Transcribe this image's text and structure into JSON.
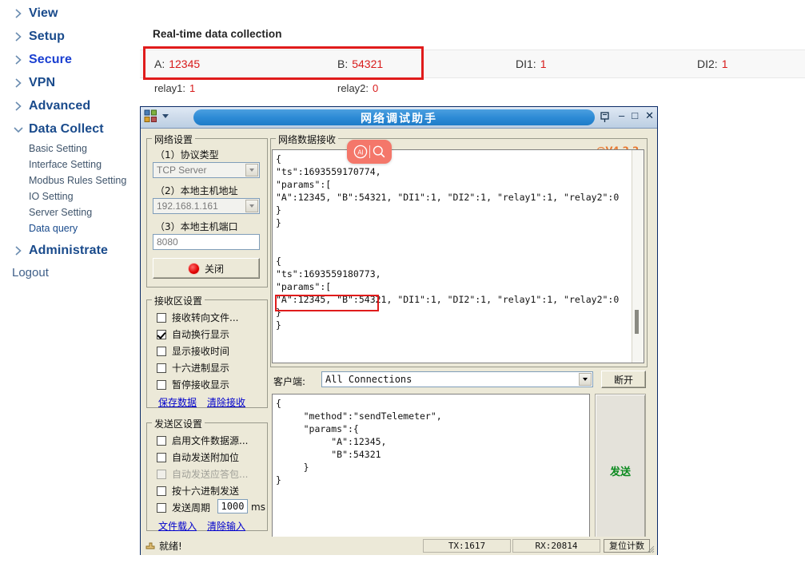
{
  "sidebar": {
    "nav": [
      {
        "label": "View",
        "expanded": false,
        "style": "dark"
      },
      {
        "label": "Setup",
        "expanded": false,
        "style": "dark"
      },
      {
        "label": "Secure",
        "expanded": false,
        "style": "bright"
      },
      {
        "label": "VPN",
        "expanded": false,
        "style": "dark"
      },
      {
        "label": "Advanced",
        "expanded": false,
        "style": "dark"
      },
      {
        "label": "Data Collect",
        "expanded": true,
        "style": "dark"
      }
    ],
    "sub_items": [
      {
        "label": "Basic Setting",
        "active": false
      },
      {
        "label": "Interface Setting",
        "active": false
      },
      {
        "label": "Modbus Rules Setting",
        "active": false
      },
      {
        "label": "IO Setting",
        "active": false
      },
      {
        "label": "Server Setting",
        "active": false
      },
      {
        "label": "Data query",
        "active": true
      }
    ],
    "nav_after": [
      {
        "label": "Administrate",
        "expanded": false,
        "style": "dark"
      }
    ],
    "logout": "Logout"
  },
  "main": {
    "section_title": "Real-time data collection",
    "metrics_row1": [
      {
        "key": "A",
        "label": "A:",
        "value": "12345"
      },
      {
        "key": "B",
        "label": "B:",
        "value": "54321"
      },
      {
        "key": "DI1",
        "label": "DI1:",
        "value": "1"
      },
      {
        "key": "DI2",
        "label": "DI2:",
        "value": "1"
      }
    ],
    "metrics_row2": [
      {
        "key": "relay1",
        "label": "relay1:",
        "value": "1"
      },
      {
        "key": "relay2",
        "label": "relay2:",
        "value": "0"
      }
    ]
  },
  "app": {
    "title": "网络调试助手",
    "version": "@V4.2.2",
    "titlebar_buttons": {
      "minimize": "–",
      "maximize": "□",
      "close": "✕"
    },
    "network_settings": {
      "group_title": "网络设置",
      "protocol_label": "（1）协议类型",
      "protocol_value": "TCP Server",
      "host_label": "（2）本地主机地址",
      "host_value": "192.168.1.161",
      "port_label": "（3）本地主机端口",
      "port_value": "8080",
      "action_button": "关闭"
    },
    "recv_settings": {
      "group_title": "接收区设置",
      "checkboxes": [
        {
          "label": "接收转向文件...",
          "checked": false,
          "disabled": false
        },
        {
          "label": "自动换行显示",
          "checked": true,
          "disabled": false
        },
        {
          "label": "显示接收时间",
          "checked": false,
          "disabled": false
        },
        {
          "label": "十六进制显示",
          "checked": false,
          "disabled": false
        },
        {
          "label": "暂停接收显示",
          "checked": false,
          "disabled": false
        }
      ],
      "links": [
        "保存数据",
        "清除接收"
      ]
    },
    "send_settings": {
      "group_title": "发送区设置",
      "checkboxes": [
        {
          "label": "启用文件数据源...",
          "checked": false,
          "disabled": false
        },
        {
          "label": "自动发送附加位",
          "checked": false,
          "disabled": false
        },
        {
          "label": "自动发送应答包...",
          "checked": false,
          "disabled": true
        },
        {
          "label": "按十六进制发送",
          "checked": false,
          "disabled": false
        },
        {
          "label": "发送周期",
          "checked": false,
          "disabled": false
        }
      ],
      "period_value": "1000",
      "period_unit": "ms",
      "links": [
        "文件载入",
        "清除输入"
      ]
    },
    "recv_panel": {
      "group_title": "网络数据接收",
      "content": "{\n\"ts\":1693559170774,\n\"params\":[\n\"A\":12345, \"B\":54321, \"DI1\":1, \"DI2\":1, \"relay1\":1, \"relay2\":0\n}\n}\n\n\n{\n\"ts\":1693559180773,\n\"params\":[\n\"A\":12345, \"B\":54321, \"DI1\":1, \"DI2\":1, \"relay1\":1, \"relay2\":0\n}\n}"
    },
    "client_bar": {
      "label": "客户端:",
      "value": "All Connections",
      "disconnect_button": "断开"
    },
    "send_panel": {
      "content": "{\n     \"method\":\"sendTelemeter\",\n     \"params\":{\n          \"A\":12345,\n          \"B\":54321\n     }\n}",
      "send_button": "发送"
    },
    "statusbar": {
      "ready": "就绪!",
      "tx": "TX:1617",
      "rx": "RX:20814",
      "reset_button": "复位计数"
    },
    "overlay_badge": {
      "ai_label": "AI",
      "search_icon": "search-icon"
    }
  },
  "colors": {
    "accent_blue": "#1a4b8c",
    "value_red": "#d81b1b",
    "highlight_red": "#e01b1b",
    "version_orange": "#e8762d",
    "send_green": "#0a8a1e",
    "badge_coral": "#f4776a"
  }
}
